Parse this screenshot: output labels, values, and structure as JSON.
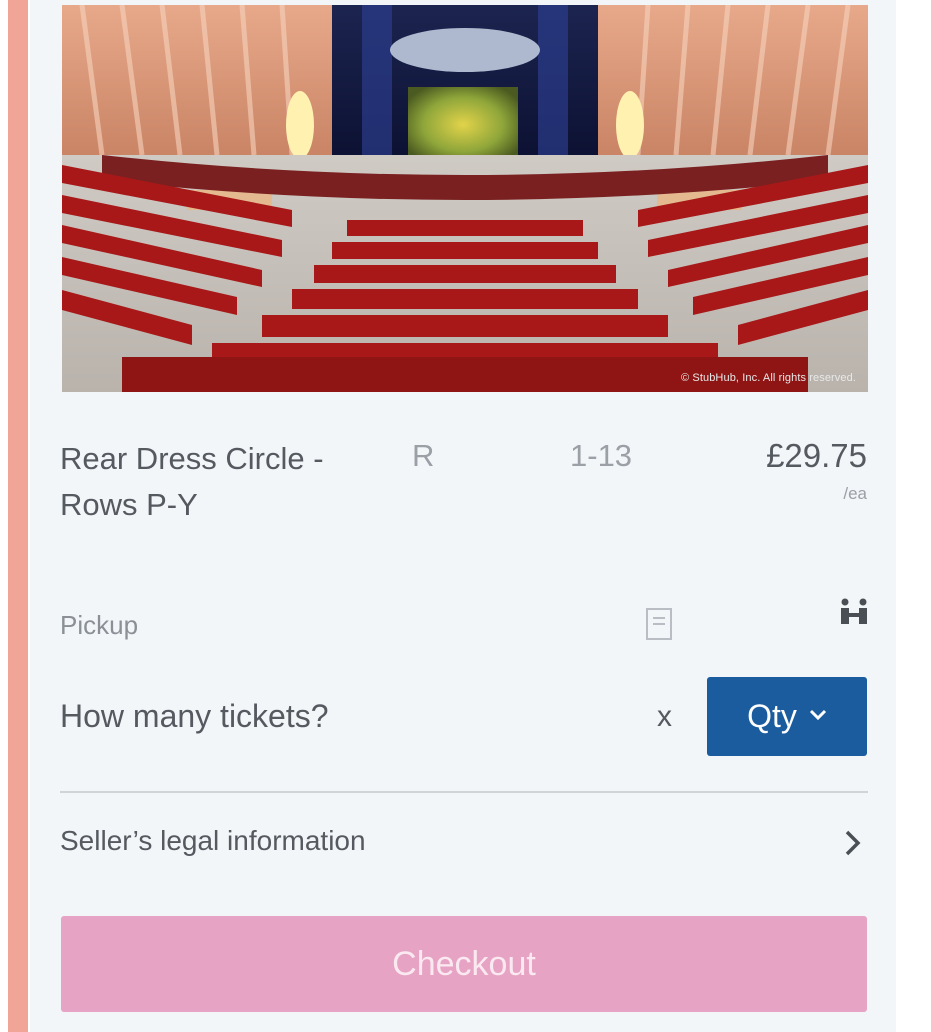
{
  "listing": {
    "section": "Rear Dress Circle - Rows P-Y",
    "row": "R",
    "seats": "1-13",
    "price": "£29.75",
    "price_unit": "/ea",
    "delivery": "Pickup",
    "image_credit": "© StubHub, Inc. All rights reserved."
  },
  "quantity": {
    "prompt": "How many tickets?",
    "multiplier": "x",
    "button_label": "Qty"
  },
  "legal": {
    "label": "Seller’s legal information"
  },
  "checkout": {
    "label": "Checkout"
  },
  "icons": {
    "doc": "document-icon",
    "together": "seats-together-icon",
    "dropdown": "chevron-down-icon",
    "legal": "chevron-right-icon"
  },
  "colors": {
    "accent": "#f0a596",
    "qty_button": "#1a5c9d",
    "checkout": "#e6a3c4"
  }
}
